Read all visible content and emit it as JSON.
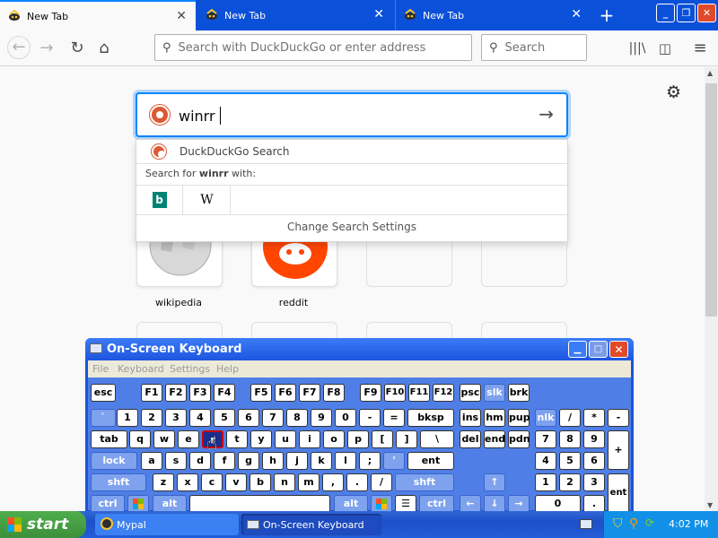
{
  "browser": {
    "tabs": [
      {
        "title": "New Tab",
        "active": true
      },
      {
        "title": "New Tab",
        "active": false
      },
      {
        "title": "New Tab",
        "active": false
      }
    ],
    "url_placeholder": "Search with DuckDuckGo or enter address",
    "search_placeholder": "Search"
  },
  "newtab": {
    "query": "winrr",
    "dropdown": {
      "engine_label": "DuckDuckGo Search",
      "search_for_prefix": "Search for ",
      "search_for_term": "winrr",
      "search_for_suffix": " with:",
      "engines": [
        "b",
        "W"
      ],
      "footer": "Change Search Settings"
    },
    "tiles": [
      {
        "label": "wikipedia"
      },
      {
        "label": "reddit"
      }
    ]
  },
  "osk": {
    "title": "On-Screen Keyboard",
    "menu": [
      "File",
      "Keyboard",
      "Settings",
      "Help"
    ],
    "keys": {
      "esc": "esc",
      "f1": "F1",
      "f2": "F2",
      "f3": "F3",
      "f4": "F4",
      "f5": "F5",
      "f6": "F6",
      "f7": "F7",
      "f8": "F8",
      "f9": "F9",
      "f10": "F10",
      "f11": "F11",
      "f12": "F12",
      "psc": "psc",
      "slk": "slk",
      "brk": "brk",
      "grave": "`",
      "n1": "1",
      "n2": "2",
      "n3": "3",
      "n4": "4",
      "n5": "5",
      "n6": "6",
      "n7": "7",
      "n8": "8",
      "n9": "9",
      "n0": "0",
      "minus": "-",
      "equals": "=",
      "bksp": "bksp",
      "ins": "ins",
      "hm": "hm",
      "pup": "pup",
      "nlk": "nlk",
      "kpdiv": "/",
      "kpmul": "*",
      "kpminus": "-",
      "tab": "tab",
      "q": "q",
      "w": "w",
      "e": "e",
      "r": "r",
      "t": "t",
      "y": "y",
      "u": "u",
      "i": "i",
      "o": "o",
      "p": "p",
      "lbr": "[",
      "rbr": "]",
      "bslash": "\\",
      "del": "del",
      "end": "end",
      "pdn": "pdn",
      "kp7": "7",
      "kp8": "8",
      "kp9": "9",
      "kpplus": "+",
      "lock": "lock",
      "a": "a",
      "s": "s",
      "d": "d",
      "f": "f",
      "g": "g",
      "h": "h",
      "j": "j",
      "k": "k",
      "l": "l",
      "semi": ";",
      "quote": "'",
      "ent": "ent",
      "kp4": "4",
      "kp5": "5",
      "kp6": "6",
      "lshft": "shft",
      "z": "z",
      "x": "x",
      "c": "c",
      "v": "v",
      "b": "b",
      "n": "n",
      "m": "m",
      "comma": ",",
      "period": ".",
      "slash": "/",
      "rshft": "shft",
      "up": "↑",
      "kp1": "1",
      "kp2": "2",
      "kp3": "3",
      "kpent": "ent",
      "lctrl": "ctrl",
      "lalt": "alt",
      "ralt": "alt",
      "rctrl": "ctrl",
      "left": "←",
      "down": "↓",
      "right": "→",
      "kp0": "0",
      "kpdot": "."
    }
  },
  "taskbar": {
    "start": "start",
    "tasks": [
      "Mypal",
      "On-Screen Keyboard"
    ],
    "clock": "4:02 PM"
  }
}
